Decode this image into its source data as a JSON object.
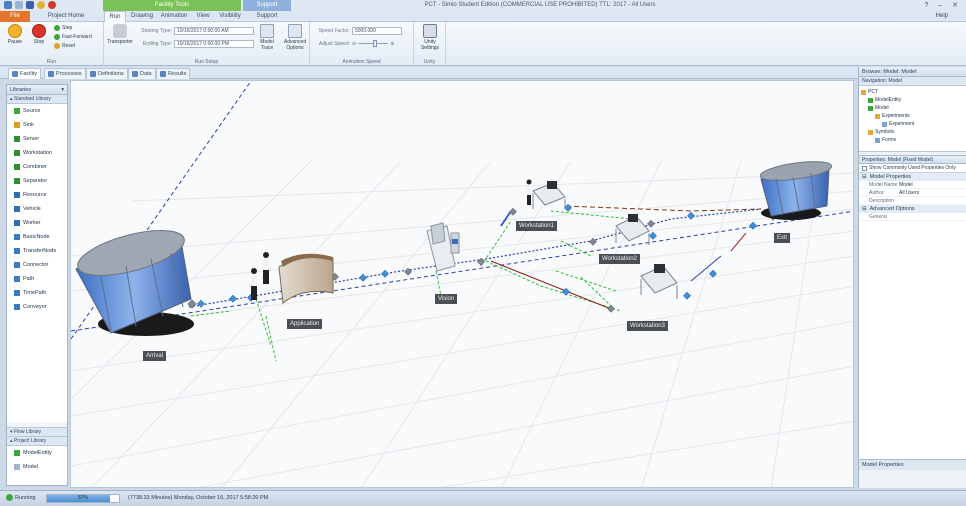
{
  "window": {
    "title": "PCT - Simio Student Edition (COMMERCIAL USE PROHIBITED) TTL: 2017 - All Users",
    "context_tab": "Facility Tools",
    "support_tab": "Support",
    "help_label": "Help",
    "controls": [
      "?",
      "–",
      "✕"
    ]
  },
  "ribbon_tabs": [
    {
      "label": "File"
    },
    {
      "label": "Project Home"
    },
    {
      "label": "Run"
    },
    {
      "label": "Drawing"
    },
    {
      "label": "Animation"
    },
    {
      "label": "View"
    },
    {
      "label": "Visibility"
    },
    {
      "label": "Support"
    }
  ],
  "ribbon": {
    "run_group": {
      "label": "Run",
      "pause": "Pause",
      "stop": "Stop",
      "step": "Step",
      "fast_forward": "Fast-Forward",
      "reset": "Reset"
    },
    "setup_group": {
      "label": "Run Setup",
      "transporter": "Transporter",
      "starting_type_label": "Starting Type:",
      "starting_type_value": "10/16/2017 0:00:00 AM",
      "ending_type_label": "Ending Type:",
      "ending_type_value": "10/16/2017 0:00:00 PM",
      "model_trace": "Model Trace",
      "advanced_options": "Advanced Options"
    },
    "speed_group": {
      "label": "Animation Speed",
      "speed_factor_label": "Speed Factor:",
      "speed_factor_value": "5000.000",
      "adjust_speed_label": "Adjust Speed:",
      "adjust_speed_fraction": 0.55
    },
    "unity_group": {
      "label": "Unity",
      "unity_settings": "Unity Settings"
    }
  },
  "window_tabs": [
    {
      "label": "Facility",
      "active": true
    },
    {
      "label": "Processes",
      "active": false
    },
    {
      "label": "Definitions",
      "active": false
    },
    {
      "label": "Data",
      "active": false
    },
    {
      "label": "Results",
      "active": false
    }
  ],
  "libraries": {
    "title": "Libraries",
    "standard_library": "Standard Library",
    "items": [
      {
        "label": "Source",
        "color": "#3aa63a"
      },
      {
        "label": "Sink",
        "color": "#d9a020"
      },
      {
        "label": "Server",
        "color": "#2f8f2f"
      },
      {
        "label": "Workstation",
        "color": "#2f8f2f"
      },
      {
        "label": "Combiner",
        "color": "#2f8f2f"
      },
      {
        "label": "Separator",
        "color": "#2f8f2f"
      },
      {
        "label": "Resource",
        "color": "#2f6fb5"
      },
      {
        "label": "Vehicle",
        "color": "#2f6fb5"
      },
      {
        "label": "Worker",
        "color": "#2f6fb5"
      },
      {
        "label": "BasicNode",
        "color": "#3d7ac2"
      },
      {
        "label": "TransferNode",
        "color": "#3d7ac2"
      },
      {
        "label": "Connector",
        "color": "#3d7ac2"
      },
      {
        "label": "Path",
        "color": "#3d7ac2"
      },
      {
        "label": "TimePath",
        "color": "#3d7ac2"
      },
      {
        "label": "Conveyor",
        "color": "#3d7ac2"
      }
    ],
    "flow_library": "Flow Library",
    "project_library": "Project Library",
    "project_items": [
      {
        "label": "ModelEntity"
      },
      {
        "label": "Model"
      }
    ]
  },
  "scene": {
    "objects": [
      {
        "label": "Arrival"
      },
      {
        "label": "Application"
      },
      {
        "label": "Vision"
      },
      {
        "label": "Workstation1"
      },
      {
        "label": "Workstation2"
      },
      {
        "label": "Workstation3"
      },
      {
        "label": "Exit"
      }
    ]
  },
  "browse": {
    "title": "Browse: Model: Model",
    "navigation": "Navigation: Model",
    "tree": [
      {
        "label": "PCT",
        "level": 0
      },
      {
        "label": "ModelEntity",
        "level": 1
      },
      {
        "label": "Model",
        "level": 1
      },
      {
        "label": "Experiments",
        "level": 2
      },
      {
        "label": "Experiment",
        "level": 3
      },
      {
        "label": "Symbols",
        "level": 1
      },
      {
        "label": "Forms",
        "level": 2
      }
    ]
  },
  "properties": {
    "title": "Properties: Model (Fixed Model)",
    "show_common": "Show Commonly Used Properties Only",
    "category": "Model Properties",
    "rows": [
      {
        "key": "Model Name",
        "value": "Model"
      },
      {
        "key": "Author",
        "value": "All Users"
      },
      {
        "key": "Description",
        "value": ""
      }
    ],
    "advanced": "Advanced Options",
    "general": "General",
    "footer": "Model Properties"
  },
  "status": {
    "state": "Running",
    "progress_text": "87%",
    "progress_fraction": 0.87,
    "time_text": "(7738.33 Minutes) Monday, October 16, 2017 5:58:20 PM"
  }
}
